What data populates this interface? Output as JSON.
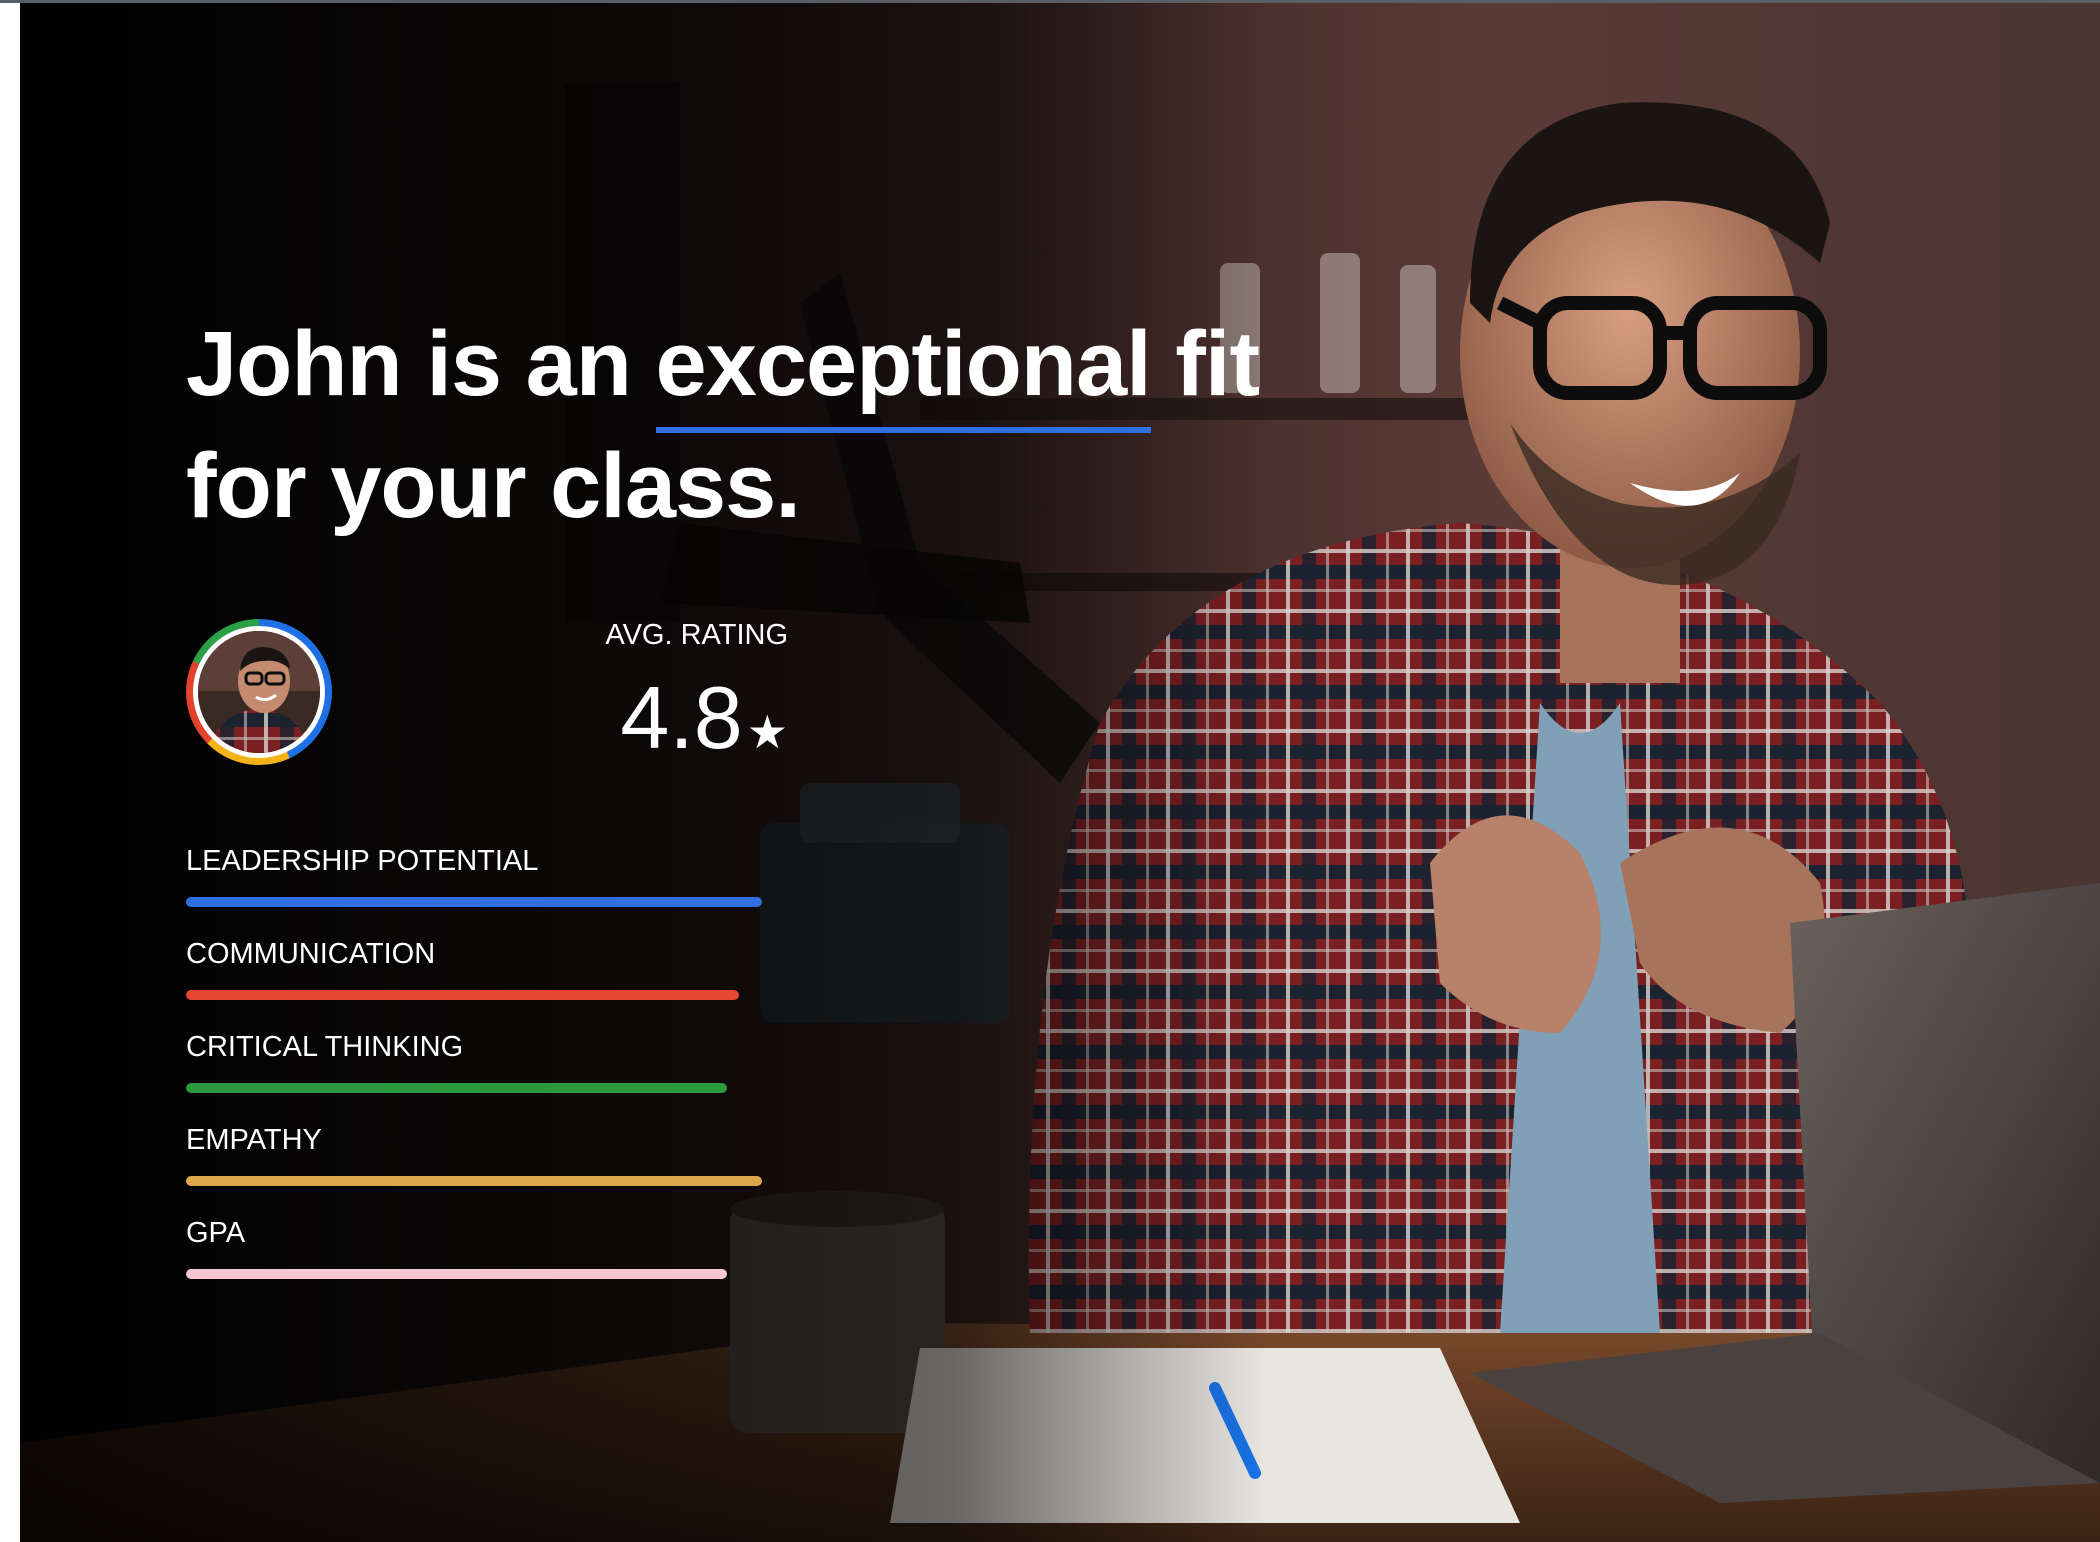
{
  "headline": {
    "before": "John is an ",
    "highlight": "exceptional",
    "after": " fit",
    "line2": "for your class."
  },
  "rating": {
    "label": "AVG. RATING",
    "value": "4.8",
    "star": "★"
  },
  "avatar": {
    "icon": "profile-photo",
    "ring_colors": [
      "#1f6fe5",
      "#f2b21a",
      "#e2432f",
      "#2aa147"
    ]
  },
  "metrics": [
    {
      "label": "LEADERSHIP POTENTIAL",
      "fill": 1.0,
      "color": "#2f6fe0"
    },
    {
      "label": "COMMUNICATION",
      "fill": 0.96,
      "color": "#e94535"
    },
    {
      "label": "CRITICAL THINKING",
      "fill": 0.94,
      "color": "#2b9a3a"
    },
    {
      "label": "EMPATHY",
      "fill": 1.0,
      "color": "#dba74a"
    },
    {
      "label": "GPA",
      "fill": 0.94,
      "color": "#f6c6d5"
    }
  ],
  "colors": {
    "accent": "#2f6fe0",
    "text": "#ffffff"
  }
}
